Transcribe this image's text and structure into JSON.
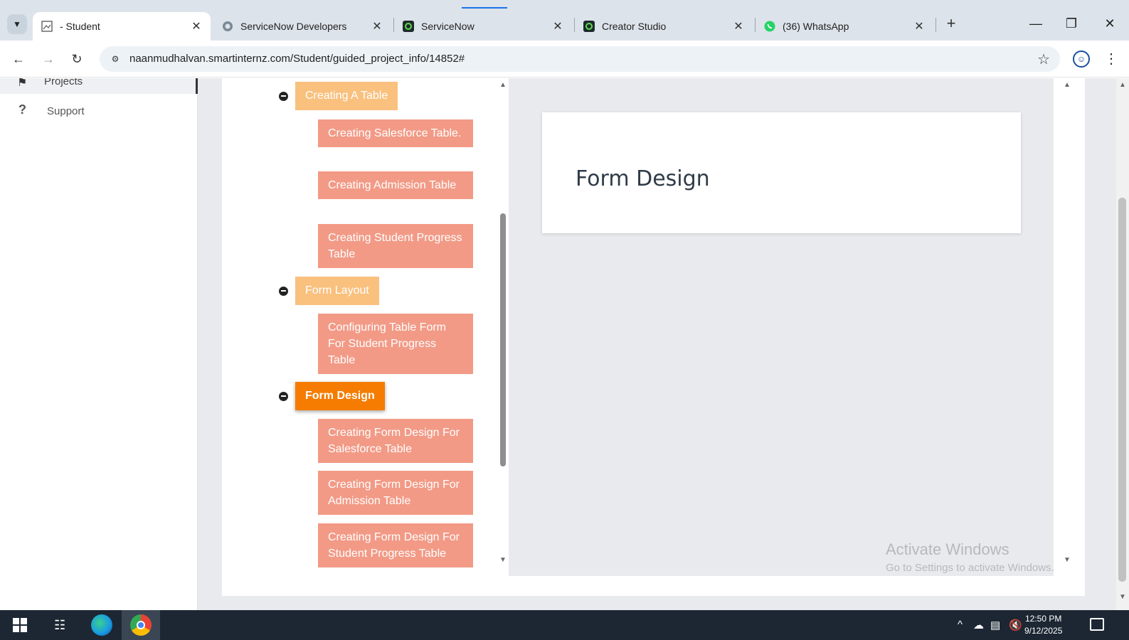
{
  "browser": {
    "tabs": [
      {
        "title": "- Student",
        "icon": "image-page-icon",
        "active": true
      },
      {
        "title": "ServiceNow Developers",
        "icon": "servicenow-developer-icon",
        "active": false
      },
      {
        "title": "ServiceNow",
        "icon": "servicenow-icon",
        "active": false
      },
      {
        "title": "Creator Studio",
        "icon": "servicenow-icon",
        "active": false
      },
      {
        "title": "(36) WhatsApp",
        "icon": "whatsapp-icon",
        "active": false
      }
    ],
    "url": "naanmudhalvan.smartinternz.com/Student/guided_project_info/14852#",
    "accent_color": "#1a73e8"
  },
  "sidebar": {
    "items": [
      {
        "label": "Projects",
        "icon": "bookmark-icon"
      },
      {
        "label": "Support",
        "icon": "question-icon"
      }
    ]
  },
  "tree": {
    "sections": [
      {
        "label": "Creating A Table",
        "active": false,
        "children": [
          "Creating Salesforce Table.",
          "Creating Admission Table",
          "Creating Student Progress Table"
        ]
      },
      {
        "label": "Form Layout",
        "active": false,
        "children": [
          "Configuring Table Form For Student Progress Table"
        ]
      },
      {
        "label": "Form Design",
        "active": true,
        "children": [
          "Creating Form Design For Salesforce Table",
          "Creating Form Design For Admission Table",
          "Creating Form Design For Student Progress Table"
        ]
      }
    ],
    "colors": {
      "section": "#f9c07e",
      "section_active": "#f57c00",
      "leaf": "#f29a86"
    }
  },
  "detail": {
    "title": "Form Design"
  },
  "watermark": {
    "line1": "Activate Windows",
    "line2": "Go to Settings to activate Windows."
  },
  "taskbar": {
    "time": "12:50 PM",
    "date": "9/12/2025"
  }
}
